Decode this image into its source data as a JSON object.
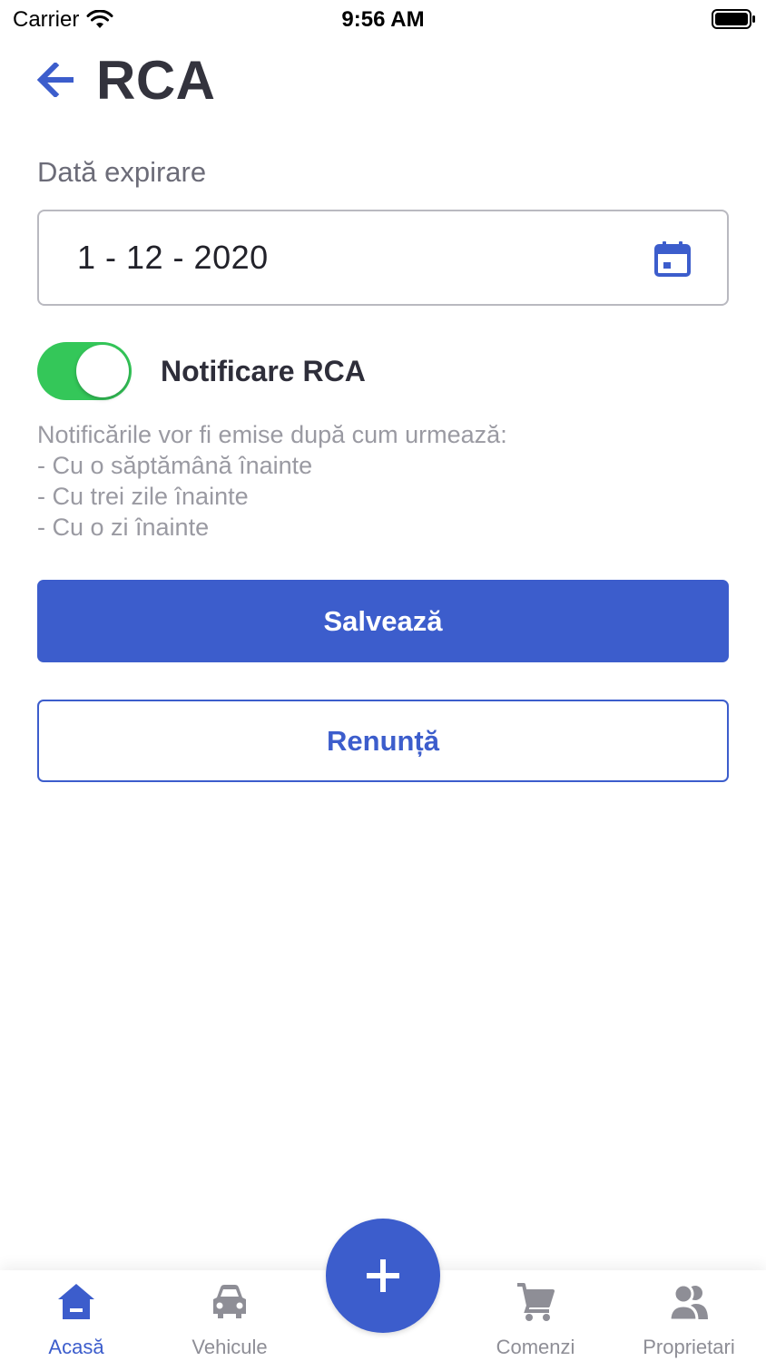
{
  "status_bar": {
    "carrier": "Carrier",
    "time": "9:56 AM"
  },
  "header": {
    "title": "RCA",
    "back_icon": "arrow-left-icon"
  },
  "form": {
    "date_label": "Dată expirare",
    "date_value": "1 - 12 - 2020",
    "calendar_icon": "calendar-icon",
    "toggle_on": true,
    "toggle_label": "Notificare RCA",
    "info_lines": [
      "Notificările vor fi emise după cum urmează:",
      "- Cu o săptămână înainte",
      "- Cu trei zile înainte",
      "- Cu o zi înainte"
    ]
  },
  "buttons": {
    "save": "Salvează",
    "cancel": "Renunță"
  },
  "tab_bar": {
    "tabs": [
      {
        "label": "Acasă",
        "icon": "home-icon",
        "active": true
      },
      {
        "label": "Vehicule",
        "icon": "car-icon",
        "active": false
      },
      {
        "label": "Comenzi",
        "icon": "cart-icon",
        "active": false
      },
      {
        "label": "Proprietari",
        "icon": "owners-icon",
        "active": false
      }
    ],
    "fab_icon": "plus-icon"
  },
  "colors": {
    "accent": "#3c5dcc",
    "toggle_on": "#34c759",
    "inactive_tab": "#8e8e96",
    "title_text": "#33333d"
  }
}
